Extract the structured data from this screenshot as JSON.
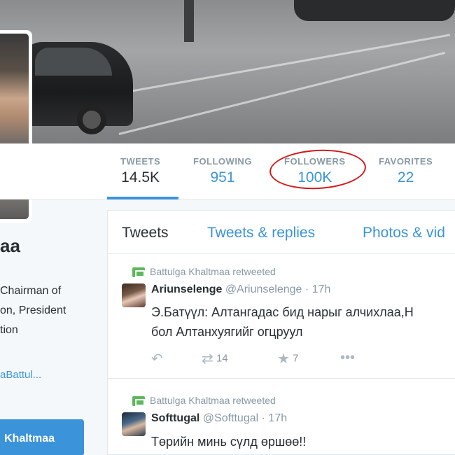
{
  "profile": {
    "name_partial": "aa",
    "bio_lines": [
      "Chairman of",
      "on, President",
      "tion"
    ],
    "link_partial": "aBattul...",
    "follow_button_label": "Khaltmaa"
  },
  "stats": [
    {
      "label": "TWEETS",
      "value": "14.5K"
    },
    {
      "label": "FOLLOWING",
      "value": "951"
    },
    {
      "label": "FOLLOWERS",
      "value": "100K"
    },
    {
      "label": "FAVORITES",
      "value": "22"
    }
  ],
  "tabs": [
    "Tweets",
    "Tweets & replies",
    "Photos & vid"
  ],
  "tweets": [
    {
      "retweet_note": "Battulga Khaltmaa retweeted",
      "name": "Ariunselenge",
      "handle": "@Ariunselenge",
      "time": "· 17h",
      "text_lines": [
        "Э.Батүүл: Алтангадас бид нарыг алчихлаа,Н",
        "бол Алтанхуягийг огцруул"
      ],
      "retweets": "14",
      "favorites": "7"
    },
    {
      "retweet_note": "Battulga Khaltmaa retweeted",
      "name": "Softtugal",
      "handle": "@Softtugal",
      "time": "· 17h",
      "text_lines": [
        "Төрийн минь сүлд өршөө!!"
      ]
    }
  ],
  "icons": {
    "reply": "reply-icon",
    "retweet": "retweet-icon",
    "favorite": "star-icon",
    "more": "more-icon"
  },
  "colors": {
    "accent": "#3b94d9",
    "annotation_circle": "#d41a1a",
    "retweet_green": "#5cb85c"
  }
}
